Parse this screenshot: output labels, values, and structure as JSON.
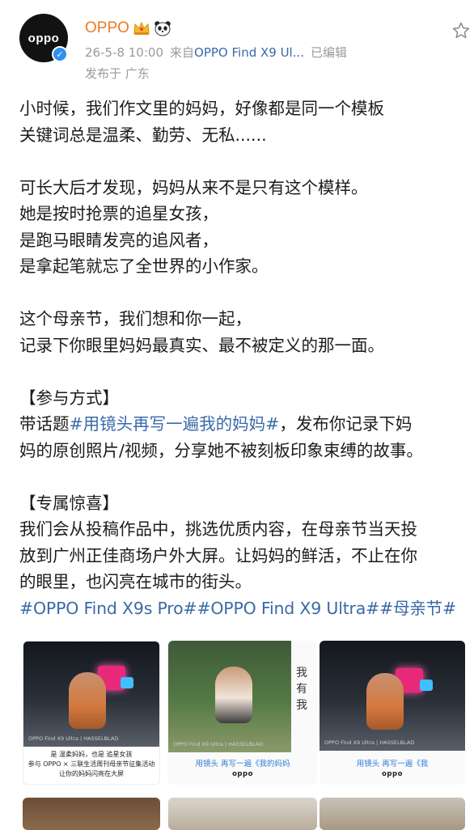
{
  "header": {
    "avatar_text": "oppo",
    "name": "OPPO",
    "crown_icon": "crown-icon",
    "panda_icon": "panda-icon",
    "date": "26-5-8 10:00",
    "source_prefix": "来自",
    "device": "OPPO Find X9 Ul...",
    "edited": "已编辑",
    "location": "发布于 广东"
  },
  "post": {
    "line1": "小时候，我们作文里的妈妈，好像都是同一个模板",
    "line2": "关键词总是温柔、勤劳、无私......",
    "line3": "可长大后才发现，妈妈从来不是只有这个模样。",
    "line4": "她是按时抢票的追星女孩，",
    "line5": "是跑马眼睛发亮的追风者，",
    "line6": "是拿起笔就忘了全世界的小作家。",
    "line7": "这个母亲节，我们想和你一起，",
    "line8": "记录下你眼里妈妈最真实、最不被定义的那一面。",
    "section1_title": "【参与方式】",
    "s1_prefix": "带话题",
    "s1_topic": "#用镜头再写一遍我的妈妈#",
    "s1_suffix": "，发布你记录下妈",
    "s1_line2": "妈的原创照片/视频，分享她不被刻板印象束缚的故事。",
    "section2_title": "【专属惊喜】",
    "s2_line1": "我们会从投稿作品中，挑选优质内容，在母亲节当天投",
    "s2_line2": "放到广州正佳商场户外大屏。让妈妈的鲜活，不止在你",
    "s2_line3": "的眼里，也闪亮在城市的街头。",
    "tags": "#OPPO Find X9s Pro##OPPO Find X9 Ultra##母亲节#"
  },
  "images": {
    "img1_caption_small": "OPPO Find X9 Ultra | HASSELBLAD",
    "img1_cap1": "是 温柔妈妈，也是 追星女孩",
    "img1_cap2": "参与 OPPO × 三联生活周刊母亲节征集活动",
    "img1_cap3": "让你的妈妈闪亮在大屏",
    "img2_caption_small": "OPPO Find X9 Ultra | HASSELBLAD",
    "img2_side": "我 有 我",
    "img2_link": "用镜头 再写一遍《我的妈妈",
    "img2_brand": "oppo",
    "img3_caption_small": "OPPO Find X9 Ultra | HASSELBLAD",
    "img3_link": "用镜头 再写一遍《我",
    "img3_brand": "oppo"
  },
  "colors": {
    "name": "#ee7a22",
    "link": "#3a6aa7",
    "meta": "#9a9a9a",
    "verified": "#2f8ff2"
  }
}
